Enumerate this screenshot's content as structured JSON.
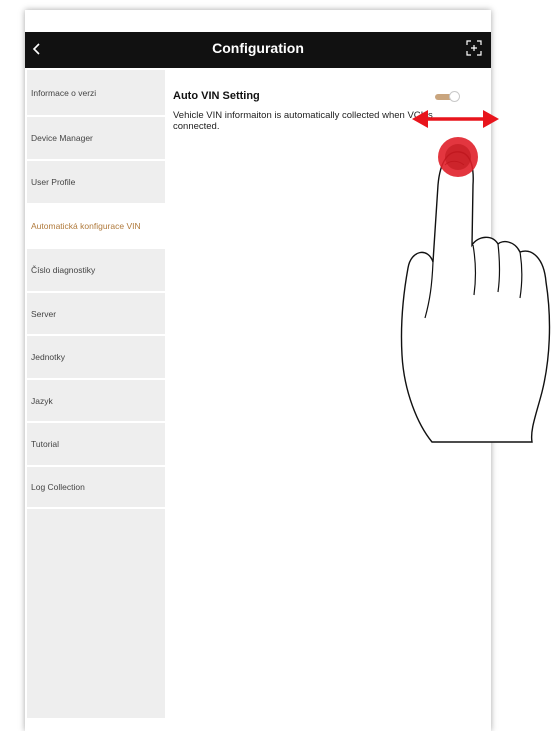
{
  "header": {
    "title": "Configuration",
    "back_icon": "chevron-left-icon",
    "fullscreen_icon": "fullscreen-icon"
  },
  "sidebar": {
    "items": [
      {
        "label": "Informace o verzi"
      },
      {
        "label": "Device Manager"
      },
      {
        "label": "User Profile"
      },
      {
        "label": "Automatická konfigurace VIN",
        "active": true
      },
      {
        "label": "Číslo diagnostiky"
      },
      {
        "label": "Server"
      },
      {
        "label": "Jednotky"
      },
      {
        "label": "Jazyk"
      },
      {
        "label": "Tutorial"
      },
      {
        "label": "Log Collection"
      }
    ]
  },
  "content": {
    "setting_title": "Auto VIN Setting",
    "setting_description": "Vehicle VIN informaiton is automatically collected when VCI is connected.",
    "toggle_on": true
  },
  "colors": {
    "titlebar": "#111111",
    "active_item_text": "#b07a3c",
    "toggle_track": "#c9a57e",
    "gesture_arrow": "#e8141c",
    "touch_point": "#e0202a"
  },
  "overlay": {
    "gesture": "horizontal-swipe-arrow-icon",
    "hand": "pointing-hand-icon"
  }
}
